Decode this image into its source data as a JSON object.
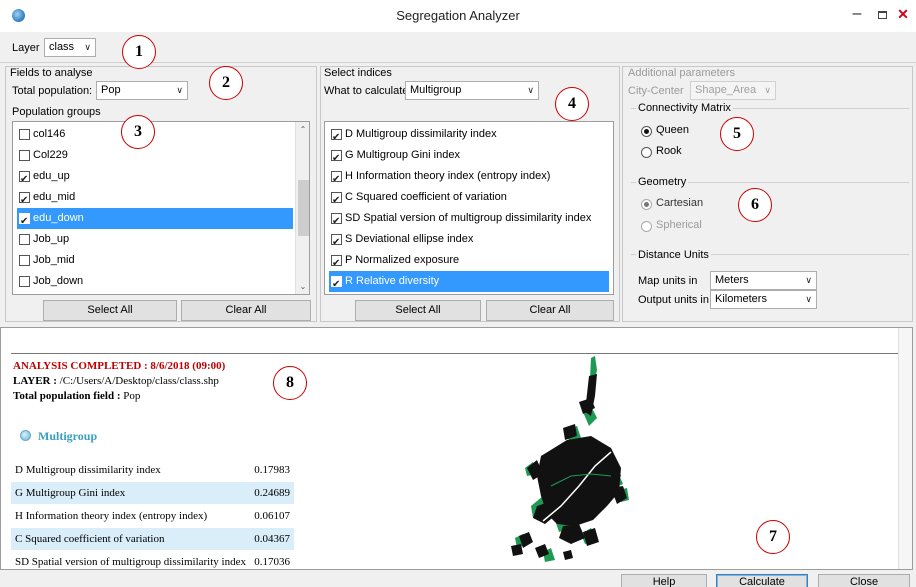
{
  "window": {
    "title": "Segregation Analyzer",
    "minimize": "–",
    "close": "✕"
  },
  "layer": {
    "label": "Layer",
    "value": "class"
  },
  "badges": [
    "1",
    "2",
    "3",
    "4",
    "5",
    "6",
    "7",
    "8"
  ],
  "fields": {
    "group_title": "Fields to analyse",
    "total_label": "Total population:",
    "total_value": "Pop",
    "groups_label": "Population groups",
    "items": [
      {
        "label": "col146",
        "checked": false,
        "selected": false
      },
      {
        "label": "Col229",
        "checked": false,
        "selected": false
      },
      {
        "label": "edu_up",
        "checked": true,
        "selected": false
      },
      {
        "label": "edu_mid",
        "checked": true,
        "selected": false
      },
      {
        "label": "edu_down",
        "checked": true,
        "selected": true
      },
      {
        "label": "Job_up",
        "checked": false,
        "selected": false
      },
      {
        "label": "Job_mid",
        "checked": false,
        "selected": false
      },
      {
        "label": "Job_down",
        "checked": false,
        "selected": false
      }
    ],
    "select_all": "Select All",
    "clear_all": "Clear All"
  },
  "indices": {
    "group_title": "Select indices",
    "what_label": "What to calculate:",
    "what_value": "Multigroup",
    "items": [
      {
        "label": "D Multigroup dissimilarity index",
        "checked": true,
        "selected": false
      },
      {
        "label": "G Multigroup Gini index",
        "checked": true,
        "selected": false
      },
      {
        "label": "H Information theory index (entropy index)",
        "checked": true,
        "selected": false
      },
      {
        "label": "C Squared coefficient of variation",
        "checked": true,
        "selected": false
      },
      {
        "label": "SD Spatial version of multigroup dissimilarity index",
        "checked": true,
        "selected": false
      },
      {
        "label": "S Deviational ellipse index",
        "checked": true,
        "selected": false
      },
      {
        "label": "P Normalized exposure",
        "checked": true,
        "selected": false
      },
      {
        "label": "R Relative diversity",
        "checked": true,
        "selected": true
      }
    ],
    "select_all": "Select All",
    "clear_all": "Clear All"
  },
  "params": {
    "group_title": "Additional parameters",
    "city_center_label": "City-Center",
    "city_center_value": "Shape_Area",
    "connectivity_title": "Connectivity Matrix",
    "queen": "Queen",
    "rook": "Rook",
    "geometry_title": "Geometry",
    "cartesian": "Cartesian",
    "spherical": "Spherical",
    "distance_title": "Distance Units",
    "map_units_label": "Map units in",
    "map_units_value": "Meters",
    "output_units_label": "Output units in",
    "output_units_value": "Kilometers"
  },
  "results": {
    "completed": "ANALYSIS COMPLETED : 8/6/2018 (09:00)",
    "layer_label": "LAYER : ",
    "layer_path": "/C:/Users/A/Desktop/class/class.shp",
    "total_label": "Total population field : ",
    "total_value": "Pop",
    "section": "Multigroup",
    "rows": [
      {
        "name": "D Multigroup dissimilarity index",
        "value": "0.17983"
      },
      {
        "name": "G Multigroup Gini index",
        "value": "0.24689"
      },
      {
        "name": "H Information theory index (entropy index)",
        "value": "0.06107"
      },
      {
        "name": "C Squared coefficient of variation",
        "value": "0.04367"
      },
      {
        "name": "SD Spatial version of multigroup dissimilarity index",
        "value": "0.17036"
      }
    ]
  },
  "footer": {
    "help": "Help",
    "calculate": "Calculate",
    "close": "Close"
  },
  "colors": {
    "selection": "#3399ff",
    "badge_border": "#cc0000",
    "completed_text": "#c00000",
    "map_green": "#1f9a55"
  }
}
